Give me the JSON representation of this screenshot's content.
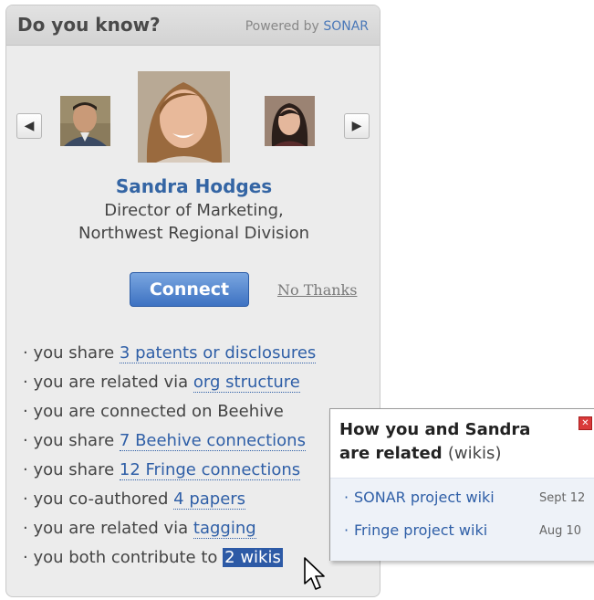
{
  "widget": {
    "title": "Do you know?",
    "powered_prefix": "Powered by",
    "powered_brand": "SONAR"
  },
  "carousel": {
    "prev_icon": "chevron-left-icon",
    "next_icon": "chevron-right-icon"
  },
  "person": {
    "name": "Sandra Hodges",
    "title_line1": "Director of Marketing,",
    "title_line2": "Northwest Regional Division"
  },
  "actions": {
    "connect_label": "Connect",
    "no_thanks_label": "No Thanks"
  },
  "reasons": [
    {
      "prefix": "you share",
      "link": "3 patents or disclosures"
    },
    {
      "prefix": "you are related via",
      "link": "org structure"
    },
    {
      "prefix": "you are connected on Beehive",
      "link": ""
    },
    {
      "prefix": "you share",
      "link": "7 Beehive connections"
    },
    {
      "prefix": "you share",
      "link": "12 Fringe connections"
    },
    {
      "prefix": "you co-authored",
      "link": "4 papers"
    },
    {
      "prefix": "you are related via",
      "link": "tagging"
    },
    {
      "prefix": "you both contribute to",
      "link": "2 wikis"
    }
  ],
  "popup": {
    "title_line1": "How you and Sandra",
    "title_line2": "are related",
    "subtitle": "(wikis)",
    "items": [
      {
        "label": "SONAR project wiki",
        "date": "Sept 12"
      },
      {
        "label": "Fringe project wiki",
        "date": "Aug 10"
      }
    ]
  },
  "colors": {
    "accent": "#3465a4",
    "link": "#2f5fa7",
    "button": "#3d72c2",
    "close": "#d93a3a"
  }
}
